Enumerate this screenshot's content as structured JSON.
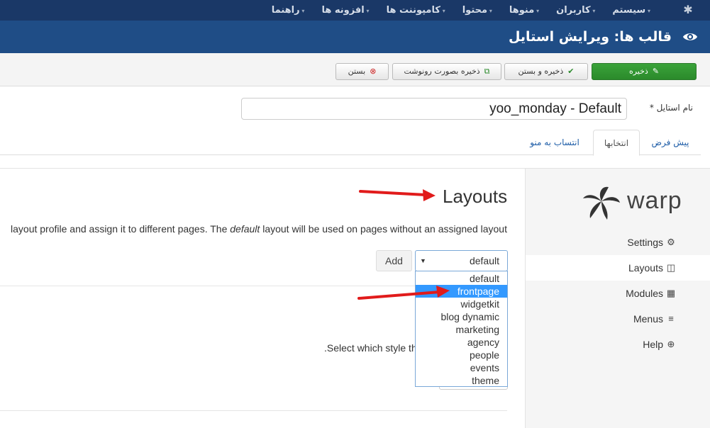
{
  "topbar": {
    "menu": [
      "سیستم",
      "کاربران",
      "منوها",
      "محتوا",
      "کامپوننت ها",
      "افزونه ها",
      "راهنما"
    ]
  },
  "header": {
    "title": "قالب ها: ویرایش استایل"
  },
  "toolbar": {
    "save": "ذخیره",
    "save_close": "ذخیره و بستن",
    "save_copy": "ذخیره بصورت رونوشت",
    "close": "بستن"
  },
  "form": {
    "style_label": "نام استایل *",
    "style_value": "yoo_monday - Default"
  },
  "tabs": [
    "پیش فرض",
    "انتخابها",
    "انتساب به منو"
  ],
  "sidebar": {
    "logo_text": "warp",
    "items": [
      {
        "label": "Settings",
        "icon": "gears-icon"
      },
      {
        "label": "Layouts",
        "icon": "columns-icon"
      },
      {
        "label": "Modules",
        "icon": "grid-icon"
      },
      {
        "label": "Menus",
        "icon": "bars-icon"
      },
      {
        "label": "Help",
        "icon": "lifebuoy-icon"
      }
    ]
  },
  "main": {
    "title": "Layouts",
    "description_visible": "layout profile and assign it to different pages. The ",
    "description_em": "default",
    "description_end": " layout will be used on pages without an assigned layout",
    "add_label": "Add",
    "selected_layout": "default",
    "layout_options": [
      "default",
      "frontpage",
      "widgetkit",
      "blog dynamic",
      "marketing",
      "agency",
      "people",
      "events",
      "theme"
    ],
    "highlighted_option": "frontpage",
    "which_style_text": ".Select which style th"
  },
  "colors": {
    "topbar": "#1a3867",
    "header": "#1f4d86",
    "save_green": "#2b8a2b",
    "highlight": "#3399ff",
    "arrow_red": "#e11b1b"
  }
}
